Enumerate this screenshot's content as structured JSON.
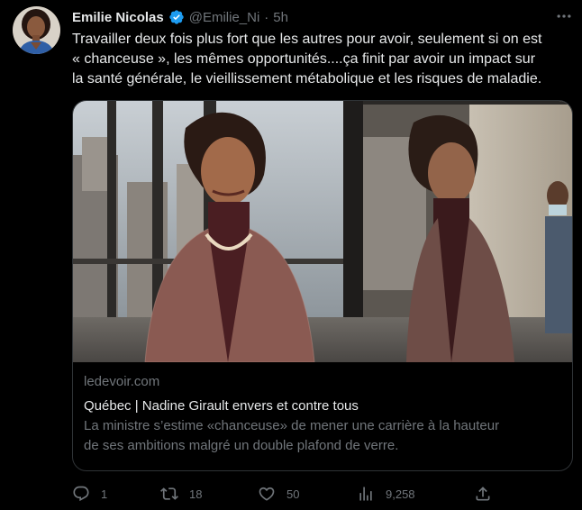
{
  "author": {
    "name": "Emilie Nicolas",
    "handle": "@Emilie_Ni",
    "separator": "·",
    "time": "5h"
  },
  "tweet": {
    "lines": [
      "Travailler deux fois plus fort que les autres pour avoir, seulement si on est",
      "« chanceuse », les mêmes opportunités....ça finit par avoir un impact sur",
      "la santé générale, le vieillissement métabolique et les risques de maladie."
    ]
  },
  "link_card": {
    "domain": "ledevoir.com",
    "title": "Québec | Nadine Girault envers et contre tous",
    "description_lines": [
      "La ministre s’estime «chanceuse» de mener une carrière à la hauteur",
      "de ses ambitions malgré un double plafond de verre."
    ]
  },
  "actions": {
    "replies": "1",
    "retweets": "18",
    "likes": "50",
    "views": "9,258"
  },
  "icons": {
    "verified": "verified-badge-icon",
    "more": "more-icon",
    "reply": "reply-icon",
    "retweet": "retweet-icon",
    "like": "heart-icon",
    "views": "views-icon",
    "share": "share-icon"
  },
  "colors": {
    "background": "#000000",
    "text": "#e7e9ea",
    "muted": "#71767b",
    "border": "#2f3336",
    "verified": "#1d9bf0"
  }
}
